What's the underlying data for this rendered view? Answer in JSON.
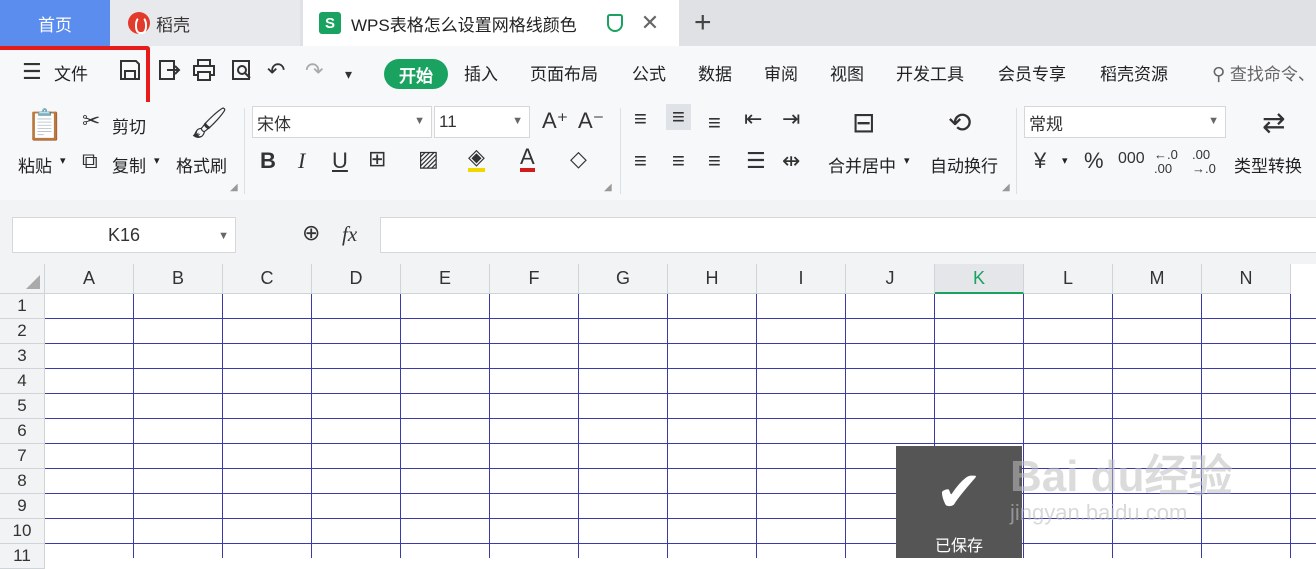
{
  "tabs": {
    "home": "首页",
    "daoke": "稻壳",
    "document": "WPS表格怎么设置网格线颜色"
  },
  "toolbar": {
    "file_label": "文件",
    "menu_tabs": [
      "开始",
      "插入",
      "页面布局",
      "公式",
      "数据",
      "审阅",
      "视图",
      "开发工具",
      "会员专享",
      "稻壳资源"
    ],
    "search_label": "查找命令、"
  },
  "ribbon": {
    "paste": "粘贴",
    "cut": "剪切",
    "copy": "复制",
    "format_painter": "格式刷",
    "font_name": "宋体",
    "font_size": "11",
    "merge_center": "合并居中",
    "wrap_text": "自动换行",
    "number_format": "常规",
    "type_convert": "类型转换",
    "currency_symbol": "¥",
    "percent_symbol": "%",
    "thousands_symbol": "000"
  },
  "formula_bar": {
    "cell_ref": "K16",
    "fx": "fx"
  },
  "grid": {
    "columns": [
      "A",
      "B",
      "C",
      "D",
      "E",
      "F",
      "G",
      "H",
      "I",
      "J",
      "K",
      "L",
      "M",
      "N"
    ],
    "selected_column": "K",
    "rows": [
      "1",
      "2",
      "3",
      "4",
      "5",
      "6",
      "7",
      "8",
      "9",
      "10",
      "11"
    ]
  },
  "toast": {
    "label": "已保存"
  },
  "watermark": {
    "brand": "Bai du经验",
    "url": "jingyan.baidu.com"
  },
  "colors": {
    "accent": "#1aa260",
    "home_tab": "#5b8def",
    "highlight_box": "#e81b1b",
    "gridline": "#3a3aa8"
  }
}
